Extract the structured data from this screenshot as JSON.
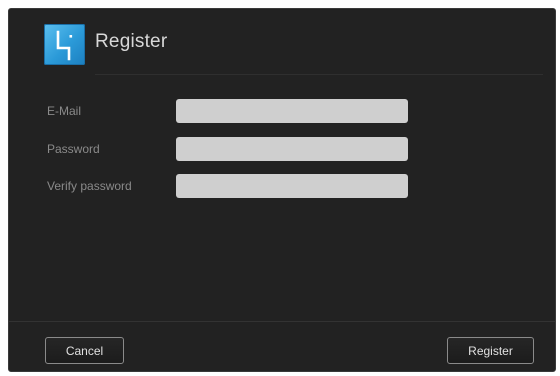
{
  "dialog": {
    "title": "Register",
    "logo_icon": "wd-logo-icon",
    "accent_color": "#2b9ad8"
  },
  "form": {
    "email_label": "E-Mail",
    "email_value": "",
    "password_label": "Password",
    "password_value": "",
    "verify_label": "Verify password",
    "verify_value": ""
  },
  "footer": {
    "cancel_label": "Cancel",
    "register_label": "Register"
  }
}
